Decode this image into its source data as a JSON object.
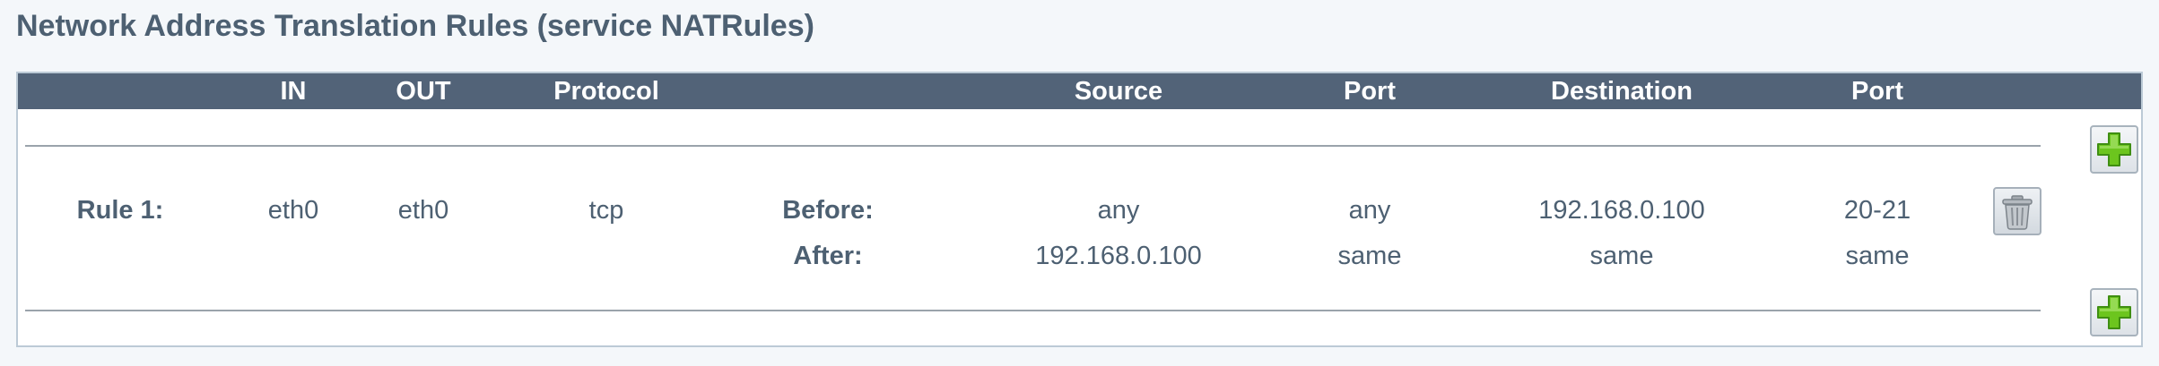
{
  "page": {
    "title": "Network Address Translation Rules (service NATRules)"
  },
  "table": {
    "headers": {
      "in": "IN",
      "out": "OUT",
      "protocol": "Protocol",
      "source": "Source",
      "source_port": "Port",
      "destination": "Destination",
      "destination_port": "Port"
    },
    "rules": [
      {
        "label": "Rule 1:",
        "in": "eth0",
        "out": "eth0",
        "protocol": "tcp",
        "before": {
          "label": "Before:",
          "source": "any",
          "source_port": "any",
          "destination": "192.168.0.100",
          "destination_port": "20-21"
        },
        "after": {
          "label": "After:",
          "source": "192.168.0.100",
          "source_port": "same",
          "destination": "same",
          "destination_port": "same"
        }
      }
    ]
  },
  "icons": {
    "add": "plus-icon",
    "delete": "trash-icon"
  },
  "colors": {
    "header_bg": "#526378",
    "text": "#4d6072",
    "add_green": "#6cc51e",
    "panel_border": "#bccad6"
  }
}
